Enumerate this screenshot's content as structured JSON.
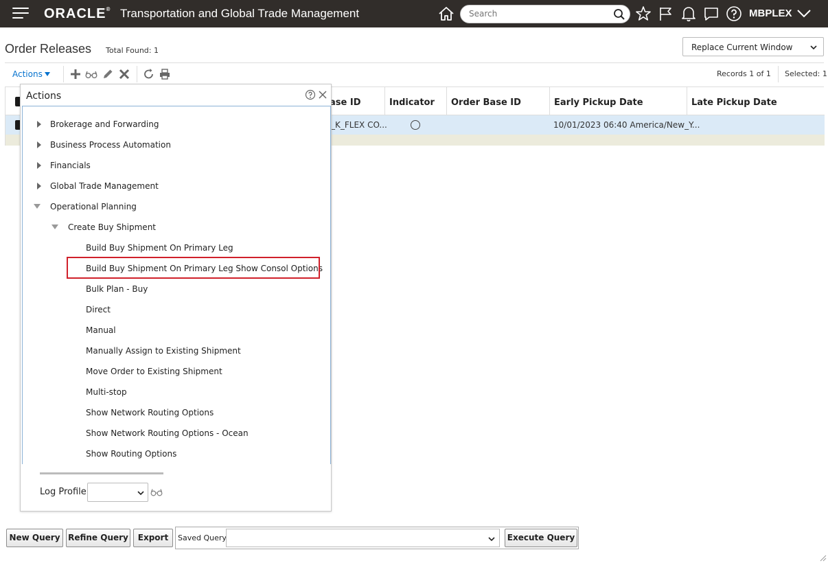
{
  "topbar": {
    "brand": "ORACLE",
    "brand_mark": "®",
    "app_title": "Transportation and Global Trade Management",
    "search_placeholder": "Search",
    "user": "MBPLEX"
  },
  "header": {
    "page_title": "Order Releases",
    "total_found": "Total Found: 1",
    "window_option": "Replace Current Window"
  },
  "toolbar": {
    "actions_label": "Actions",
    "records": "Records  1  of  1",
    "selected": "Selected: 1"
  },
  "grid": {
    "columns": [
      "ase ID",
      "Indicator",
      "Order Base ID",
      "Early Pickup Date",
      "Late Pickup Date"
    ],
    "row": {
      "base_id": "_K_FLEX CO...",
      "early_pickup": "10/01/2023 06:40 America/New_Y..."
    }
  },
  "actions_popup": {
    "title": "Actions",
    "items": [
      "Brokerage and Forwarding",
      "Business Process Automation",
      "Financials",
      "Global Trade Management",
      "Operational Planning",
      "Create Buy Shipment",
      "Build Buy Shipment On Primary Leg",
      "Build Buy Shipment On Primary Leg Show Consol Options",
      "Bulk Plan - Buy",
      "Direct",
      "Manual",
      "Manually Assign to Existing Shipment",
      "Move Order to Existing Shipment",
      "Multi-stop",
      "Show Network Routing Options",
      "Show Network Routing Options - Ocean",
      "Show Routing Options"
    ],
    "log_profile_label": "Log Profile"
  },
  "bottom": {
    "new_query": "New Query",
    "refine_query": "Refine Query",
    "export": "Export",
    "saved_query_label": "Saved Query:",
    "execute_query": "Execute Query"
  }
}
